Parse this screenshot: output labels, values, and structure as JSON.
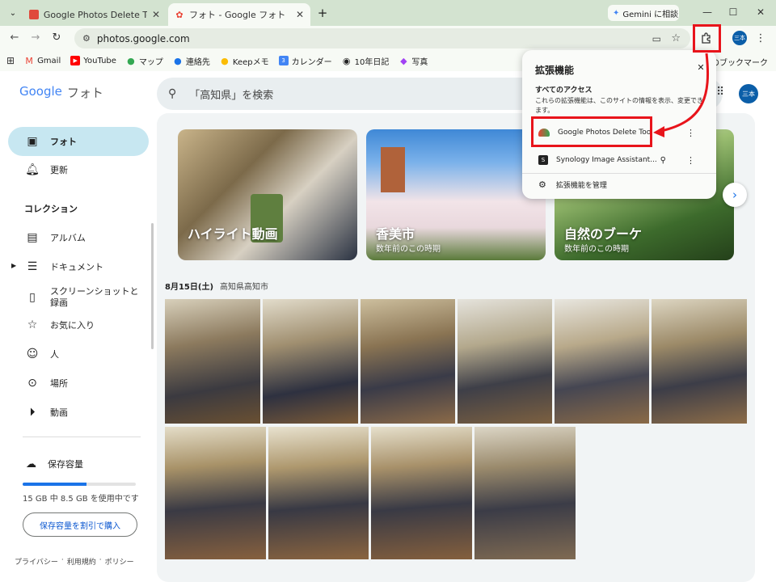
{
  "browser": {
    "tabs": [
      {
        "title": "Google Photos Delete Tool - Ch",
        "active": false
      },
      {
        "title": "フォト - Google フォト",
        "active": true
      }
    ],
    "gemini_button": "Gemini に相談",
    "url": "photos.google.com",
    "profile_avatar": "三本",
    "bookmarks": [
      "Gmail",
      "YouTube",
      "マップ",
      "連絡先",
      "Keepメモ",
      "カレンダー",
      "10年日記",
      "写真"
    ],
    "all_bookmarks": "すべてのブックマーク"
  },
  "app": {
    "logo_google": "Google",
    "logo_product": "フォト",
    "search_placeholder": "「高知県」を検索",
    "avatar": "三本"
  },
  "sidebar": {
    "photos": "フォト",
    "updates": "更新",
    "collections_header": "コレクション",
    "albums": "アルバム",
    "documents": "ドキュメント",
    "screenshots": "スクリーンショットと録画",
    "favorites": "お気に入り",
    "people": "人",
    "places": "場所",
    "videos": "動画",
    "storage_title": "保存容量",
    "storage_text": "15 GB 中 8.5 GB を使用中です",
    "storage_fraction": 0.567,
    "storage_button": "保存容量を割引で購入",
    "footer": [
      "プライバシー",
      "利用規約",
      "ポリシー"
    ]
  },
  "memories": [
    {
      "title": "ハイライト動画",
      "subtitle": ""
    },
    {
      "title": "香美市",
      "subtitle": "数年前のこの時期"
    },
    {
      "title": "自然のブーケ",
      "subtitle": "数年前のこの時期"
    }
  ],
  "date_section": {
    "date": "8月15日(土)",
    "location": "高知県高知市"
  },
  "extensions_popup": {
    "title": "拡張機能",
    "access_header": "すべてのアクセス",
    "access_desc": "これらの拡張機能は、このサイトの情報を表示、変更できます。",
    "items": [
      {
        "name": "Google Photos Delete Tool",
        "highlighted": true
      },
      {
        "name": "Synology Image Assistant...",
        "highlighted": false
      }
    ],
    "manage": "拡張機能を管理"
  },
  "annotation_color": "#e8141b"
}
